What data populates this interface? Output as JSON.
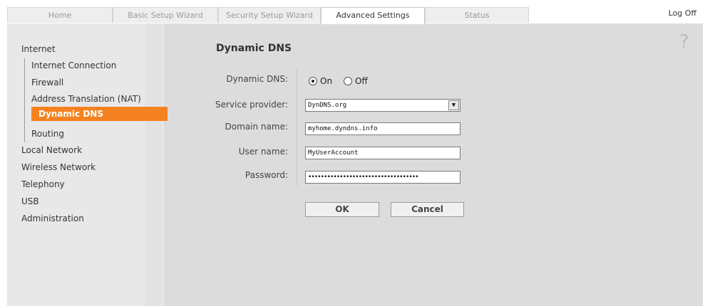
{
  "tabs": [
    {
      "label": "Home"
    },
    {
      "label": "Basic Setup Wizard"
    },
    {
      "label": "Security Setup Wizard"
    },
    {
      "label": "Advanced Settings"
    },
    {
      "label": "Status"
    }
  ],
  "header": {
    "logoff": "Log Off"
  },
  "sidebar": {
    "internet": "Internet",
    "internet_children": [
      "Internet Connection",
      "Firewall",
      "Address Translation (NAT)",
      "Dynamic DNS",
      "Routing"
    ],
    "other_items": [
      "Local Network",
      "Wireless Network",
      "Telephony",
      "USB",
      "Administration"
    ],
    "active": "Dynamic DNS"
  },
  "main": {
    "title": "Dynamic DNS",
    "help_icon": "?",
    "fields": {
      "dynamic_dns_label": "Dynamic DNS:",
      "on_label": "On",
      "off_label": "Off",
      "selected": "On",
      "service_provider_label": "Service provider:",
      "service_provider_value": "DynDNS.org",
      "domain_name_label": "Domain name:",
      "domain_name_value": "myhome.dyndns.info",
      "user_name_label": "User name:",
      "user_name_value": "MyUserAccount",
      "password_label": "Password:",
      "password_value": "•••••••••••••••••••••••••••••••••••"
    },
    "buttons": {
      "ok": "OK",
      "cancel": "Cancel"
    }
  },
  "colors": {
    "accent": "#f58220"
  }
}
